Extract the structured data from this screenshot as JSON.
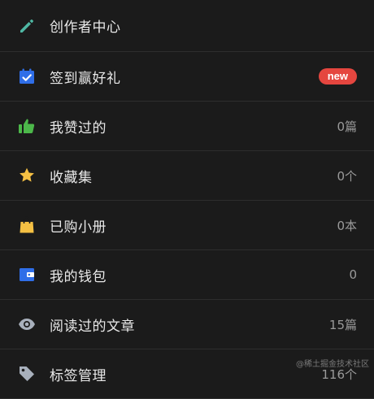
{
  "menu": {
    "items": [
      {
        "label": "创作者中心",
        "value": "",
        "icon": "pencil-icon",
        "icon_color": "#4fb8a4"
      },
      {
        "label": "签到赢好礼",
        "badge": "new",
        "icon": "calendar-check-icon",
        "icon_color": "#2f6ee8"
      },
      {
        "label": "我赞过的",
        "value": "0篇",
        "icon": "thumbs-up-icon",
        "icon_color": "#4cb84a"
      },
      {
        "label": "收藏集",
        "value": "0个",
        "icon": "star-icon",
        "icon_color": "#f5c043"
      },
      {
        "label": "已购小册",
        "value": "0本",
        "icon": "shopping-bag-icon",
        "icon_color": "#f5c043"
      },
      {
        "label": "我的钱包",
        "value": "0",
        "icon": "wallet-icon",
        "icon_color": "#2f6ee8"
      },
      {
        "label": "阅读过的文章",
        "value": "15篇",
        "icon": "eye-icon",
        "icon_color": "#a8b0bc"
      },
      {
        "label": "标签管理",
        "value": "116个",
        "icon": "tag-icon",
        "icon_color": "#a8b0bc"
      }
    ]
  },
  "watermark": "@稀土掘金技术社区",
  "colors": {
    "background": "#1b1b1b",
    "divider": "#2e2e2e",
    "badge": "#e5463f"
  }
}
